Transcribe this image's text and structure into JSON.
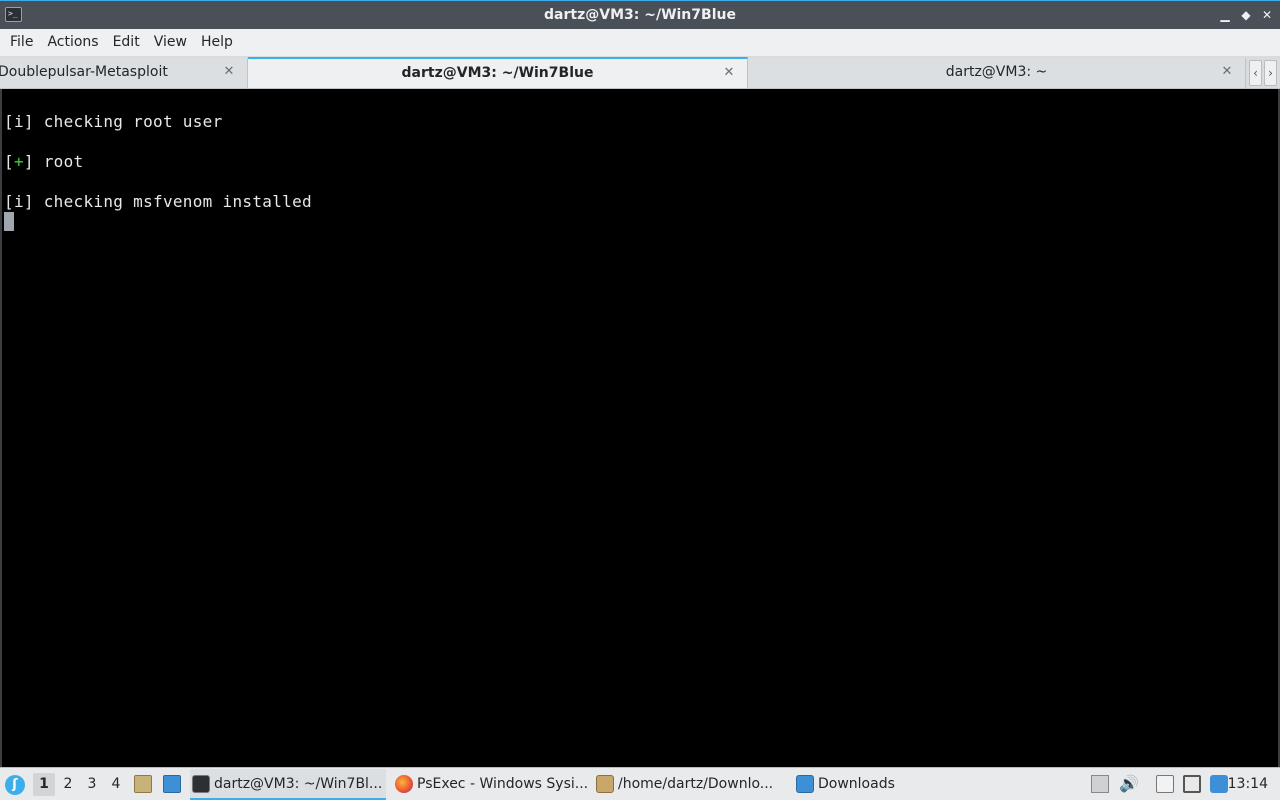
{
  "window": {
    "title": "dartz@VM3: ~/Win7Blue",
    "minimize_glyph": "▁",
    "maximize_glyph": "◆",
    "close_glyph": "✕"
  },
  "menu": [
    "File",
    "Actions",
    "Edit",
    "View",
    "Help"
  ],
  "tabs": [
    {
      "label": "Doublepulsar-Metasploit",
      "active": false
    },
    {
      "label": "dartz@VM3: ~/Win7Blue",
      "active": true
    },
    {
      "label": "dartz@VM3: ~",
      "active": false
    }
  ],
  "tab_close_glyph": "✕",
  "tab_scroll": {
    "left": "‹",
    "right": "›"
  },
  "terminal": {
    "lines": [
      {
        "prefix_open": "[",
        "prefix_mark": "i",
        "prefix_close": "]",
        "text": " checking root user"
      },
      {
        "prefix_open": "[",
        "prefix_mark": "+",
        "prefix_close": "]",
        "text": " root"
      },
      {
        "prefix_open": "[",
        "prefix_mark": "i",
        "prefix_close": "]",
        "text": " checking msfvenom installed"
      }
    ]
  },
  "taskbar": {
    "desktops": [
      "1",
      "2",
      "3",
      "4"
    ],
    "active_desktop": "1",
    "tasks": [
      {
        "label": "dartz@VM3: ~/Win7Bl...",
        "icon": "terminal-icon",
        "active": true
      },
      {
        "label": "PsExec - Windows Sysi...",
        "icon": "firefox-icon",
        "active": false
      },
      {
        "label": "/home/dartz/Downlo...",
        "icon": "archive-icon",
        "active": false
      },
      {
        "label": "Downloads",
        "icon": "folder-icon",
        "active": false
      }
    ],
    "clock": "13:14"
  },
  "colors": {
    "accent": "#3daee9",
    "terminal_bg": "#000000",
    "terminal_fg": "#e8e8e8",
    "success_green": "#3bd13b"
  }
}
